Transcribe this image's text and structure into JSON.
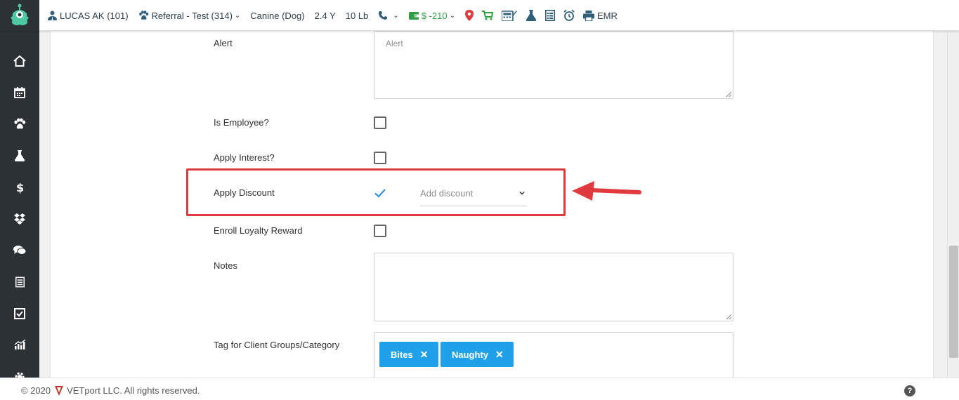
{
  "header": {
    "client_name": "LUCAS AK (101)",
    "patient_name": "Referral - Test (314)",
    "species": "Canine (Dog)",
    "age": "2.4 Y",
    "weight": "10 Lb",
    "balance": "$ -210",
    "emr_label": "EMR"
  },
  "form": {
    "alert_label": "Alert",
    "alert_placeholder": "Alert",
    "is_employee_label": "Is Employee?",
    "apply_interest_label": "Apply Interest?",
    "apply_discount_label": "Apply Discount",
    "discount_placeholder": "Add discount",
    "enroll_loyalty_label": "Enroll Loyalty Reward",
    "notes_label": "Notes",
    "tags_label": "Tag for Client Groups/Category",
    "tags": [
      "Bites",
      "Naughty"
    ]
  },
  "footer": {
    "copyright": "© 2020",
    "company": "VETport LLC. All rights reserved."
  },
  "colors": {
    "sidebar": "#2c3136",
    "accent": "#1ea1e8",
    "highlight": "#e0393e",
    "money": "#2f9e44"
  }
}
